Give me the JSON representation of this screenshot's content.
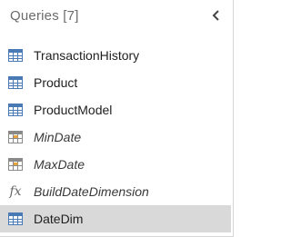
{
  "pane": {
    "title": "Queries [7]",
    "collapse_icon": "chevron-left-icon"
  },
  "queries": [
    {
      "label": "TransactionHistory",
      "icon": "table-icon",
      "italic": false,
      "selected": false
    },
    {
      "label": "Product",
      "icon": "table-icon",
      "italic": false,
      "selected": false
    },
    {
      "label": "ProductModel",
      "icon": "table-icon",
      "italic": false,
      "selected": false
    },
    {
      "label": "MinDate",
      "icon": "parameter-table-icon",
      "italic": true,
      "selected": false
    },
    {
      "label": "MaxDate",
      "icon": "parameter-table-icon",
      "italic": true,
      "selected": false
    },
    {
      "label": "BuildDateDimension",
      "icon": "function-icon",
      "glyph": "fx",
      "italic": true,
      "selected": false
    },
    {
      "label": "DateDim",
      "icon": "table-icon",
      "italic": false,
      "selected": true
    }
  ],
  "colors": {
    "table_icon": "#4a7ab5",
    "parameter_icon": "#e8a33d",
    "selected_bg": "#d9d9d9"
  }
}
